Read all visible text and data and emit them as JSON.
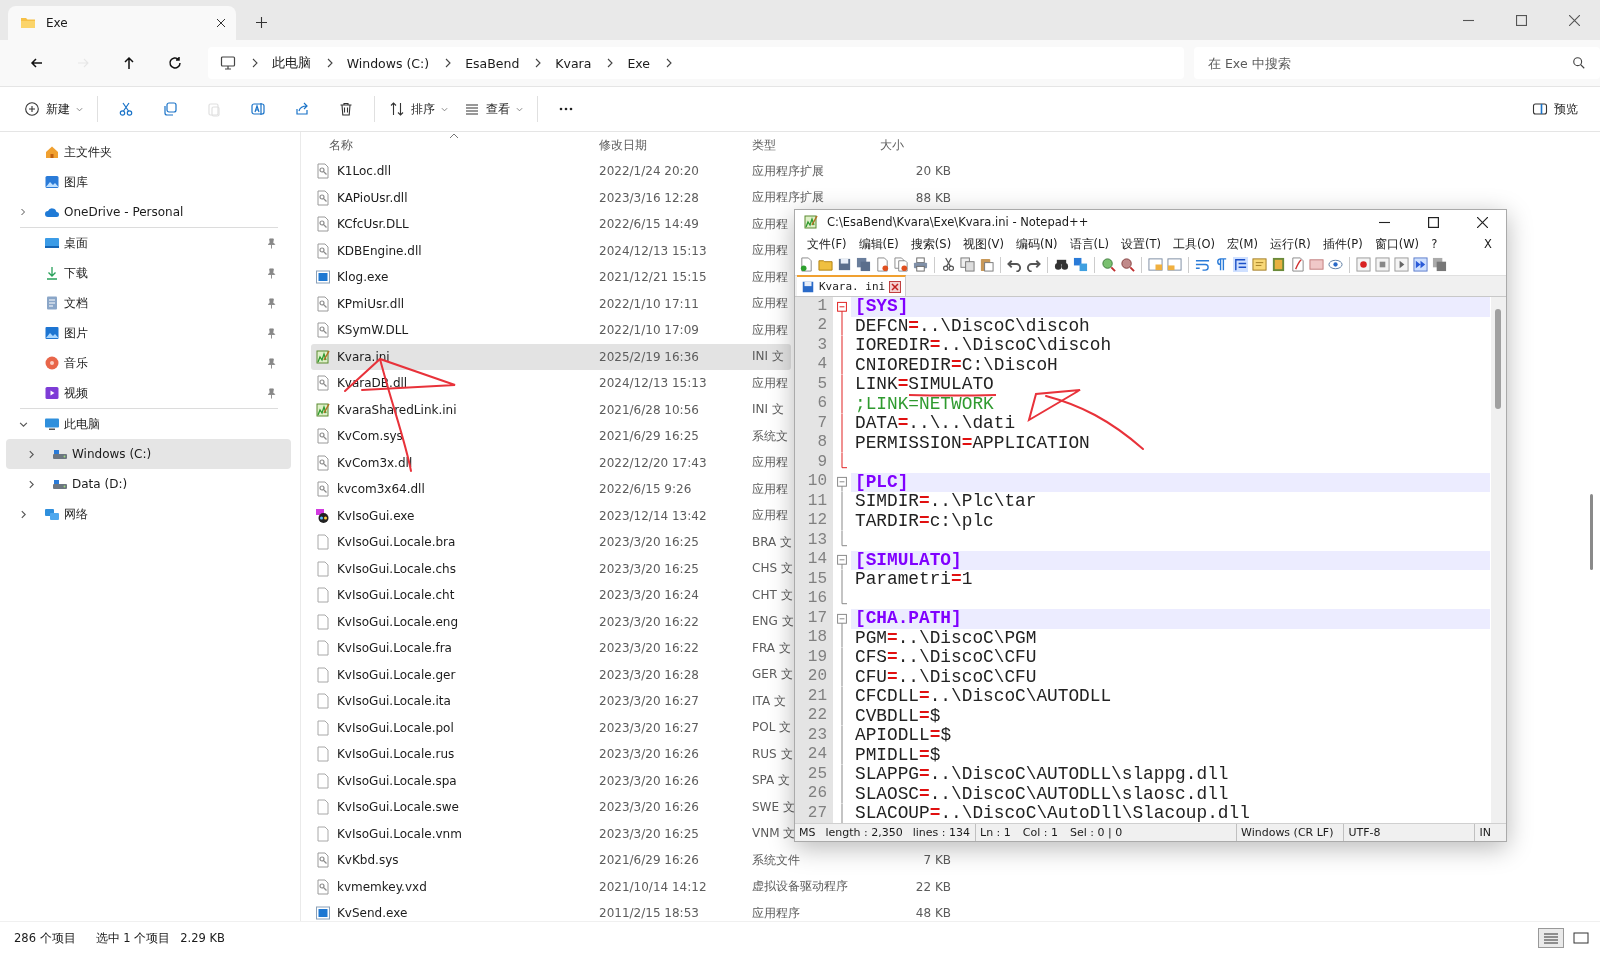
{
  "tabs": [
    {
      "label": "Exe",
      "selected": true
    }
  ],
  "nav": [
    {
      "kind": "back",
      "disabled": false
    },
    {
      "kind": "forward",
      "disabled": true
    },
    {
      "kind": "up",
      "disabled": false
    },
    {
      "kind": "refresh",
      "disabled": false
    }
  ],
  "address": {
    "segments": [
      "此电脑",
      "Windows (C:)",
      "EsaBend",
      "Kvara",
      "Exe"
    ]
  },
  "search": {
    "placeholder": "在 Exe 中搜索"
  },
  "commands": [
    {
      "kind": "new",
      "label": "新建",
      "disabled": false
    },
    {
      "kind": "cut",
      "disabled": false
    },
    {
      "kind": "copy",
      "disabled": false
    },
    {
      "kind": "paste",
      "disabled": true
    },
    {
      "kind": "rename",
      "disabled": false
    },
    {
      "kind": "share",
      "disabled": false
    },
    {
      "kind": "delete",
      "disabled": false
    },
    {
      "kind": "sort",
      "label": "排序",
      "disabled": false
    },
    {
      "kind": "view",
      "label": "查看",
      "disabled": false
    },
    {
      "kind": "more",
      "disabled": false
    }
  ],
  "preview": {
    "label": "预览"
  },
  "sidebar": {
    "top": [
      {
        "kind": "home",
        "label": "主文件夹"
      },
      {
        "kind": "gallery",
        "label": "图库"
      },
      {
        "kind": "cloud",
        "label": "OneDrive - Personal",
        "expanded": false
      }
    ],
    "pinned": [
      {
        "kind": "desktop",
        "label": "桌面",
        "pinned": true
      },
      {
        "kind": "download",
        "label": "下载",
        "pinned": true
      },
      {
        "kind": "docs",
        "label": "文档",
        "pinned": true
      },
      {
        "kind": "pictures",
        "label": "图片",
        "pinned": true
      },
      {
        "kind": "music",
        "label": "音乐",
        "pinned": true
      },
      {
        "kind": "videos",
        "label": "视频",
        "pinned": true
      }
    ],
    "tree": [
      {
        "kind": "pc",
        "label": "此电脑",
        "expanded": true,
        "selected": false,
        "children": [
          {
            "kind": "drive",
            "label": "Windows (C:)",
            "expanded": false,
            "selected": true
          },
          {
            "kind": "drive",
            "label": "Data (D:)",
            "expanded": false,
            "selected": false
          }
        ]
      },
      {
        "kind": "network",
        "label": "网络",
        "expanded": false,
        "selected": false
      }
    ]
  },
  "files": {
    "columns": [
      "名称",
      "修改日期",
      "类型",
      "大小"
    ],
    "rows": [
      {
        "kind": "dll",
        "name": "K1Loc.dll",
        "date": "2022/1/24 20:20",
        "type": "应用程序扩展",
        "size": "20 KB",
        "selected": false
      },
      {
        "kind": "dll",
        "name": "KAPioUsr.dll",
        "date": "2023/3/16 12:28",
        "type": "应用程序扩展",
        "size": "88 KB",
        "selected": false
      },
      {
        "kind": "dll",
        "name": "KCfcUsr.DLL",
        "date": "2022/6/15 14:49",
        "type": "应用程",
        "selected": false
      },
      {
        "kind": "dll",
        "name": "KDBEngine.dll",
        "date": "2024/12/13 15:13",
        "type": "应用程",
        "selected": false
      },
      {
        "kind": "exe",
        "name": "Klog.exe",
        "date": "2021/12/21 15:15",
        "type": "应用程",
        "selected": false
      },
      {
        "kind": "dll",
        "name": "KPmiUsr.dll",
        "date": "2022/1/10 17:11",
        "type": "应用程",
        "selected": false
      },
      {
        "kind": "dll",
        "name": "KSymW.DLL",
        "date": "2022/1/10 17:09",
        "type": "应用程",
        "selected": false
      },
      {
        "kind": "ini",
        "name": "Kvara.ini",
        "date": "2025/2/19 16:36",
        "type": "INI 文",
        "selected": true
      },
      {
        "kind": "dll",
        "name": "KvaraDB.dll",
        "date": "2024/12/13 15:13",
        "type": "应用程",
        "selected": false
      },
      {
        "kind": "ini",
        "name": "KvaraSharedLink.ini",
        "date": "2021/6/28 10:56",
        "type": "INI 文",
        "selected": false
      },
      {
        "kind": "dll",
        "name": "KvCom.sys",
        "date": "2021/6/29 16:25",
        "type": "系统文",
        "selected": false
      },
      {
        "kind": "dll",
        "name": "KvCom3x.dll",
        "date": "2022/12/20 17:43",
        "type": "应用程",
        "selected": false
      },
      {
        "kind": "dll",
        "name": "kvcom3x64.dll",
        "date": "2022/6/15 9:26",
        "type": "应用程",
        "selected": false
      },
      {
        "kind": "app",
        "name": "KvIsoGui.exe",
        "date": "2023/12/14 13:42",
        "type": "应用程",
        "selected": false
      },
      {
        "kind": "blank",
        "name": "KvIsoGui.Locale.bra",
        "date": "2023/3/20 16:25",
        "type": "BRA 文",
        "selected": false
      },
      {
        "kind": "blank",
        "name": "KvIsoGui.Locale.chs",
        "date": "2023/3/20 16:25",
        "type": "CHS 文",
        "selected": false
      },
      {
        "kind": "blank",
        "name": "KvIsoGui.Locale.cht",
        "date": "2023/3/20 16:24",
        "type": "CHT 文",
        "selected": false
      },
      {
        "kind": "blank",
        "name": "KvIsoGui.Locale.eng",
        "date": "2023/3/20 16:22",
        "type": "ENG 文",
        "selected": false
      },
      {
        "kind": "blank",
        "name": "KvIsoGui.Locale.fra",
        "date": "2023/3/20 16:22",
        "type": "FRA 文",
        "selected": false
      },
      {
        "kind": "blank",
        "name": "KvIsoGui.Locale.ger",
        "date": "2023/3/20 16:28",
        "type": "GER 文",
        "selected": false
      },
      {
        "kind": "blank",
        "name": "KvIsoGui.Locale.ita",
        "date": "2023/3/20 16:27",
        "type": "ITA 文",
        "selected": false
      },
      {
        "kind": "blank",
        "name": "KvIsoGui.Locale.pol",
        "date": "2023/3/20 16:27",
        "type": "POL 文",
        "selected": false
      },
      {
        "kind": "blank",
        "name": "KvIsoGui.Locale.rus",
        "date": "2023/3/20 16:26",
        "type": "RUS 文",
        "selected": false
      },
      {
        "kind": "blank",
        "name": "KvIsoGui.Locale.spa",
        "date": "2023/3/20 16:26",
        "type": "SPA 文",
        "selected": false
      },
      {
        "kind": "blank",
        "name": "KvIsoGui.Locale.swe",
        "date": "2023/3/20 16:26",
        "type": "SWE 文",
        "selected": false
      },
      {
        "kind": "blank",
        "name": "KvIsoGui.Locale.vnm",
        "date": "2023/3/20 16:25",
        "type": "VNM 文",
        "selected": false
      },
      {
        "kind": "dll",
        "name": "KvKbd.sys",
        "date": "2021/6/29 16:26",
        "type": "系统文件",
        "size": "7 KB",
        "selected": false
      },
      {
        "kind": "dll",
        "name": "kvmemkey.vxd",
        "date": "2021/10/14 14:12",
        "type": "虚拟设备驱动程序",
        "size": "22 KB",
        "selected": false
      },
      {
        "kind": "exe",
        "name": "KvSend.exe",
        "date": "2011/2/15 18:53",
        "type": "应用程序",
        "size": "48 KB",
        "selected": false
      }
    ]
  },
  "status_bar": {
    "count": "286 个项目",
    "selection": "选中 1 个项目",
    "selection_size": "2.29 KB"
  },
  "views": [
    {
      "kind": "details",
      "selected": true
    },
    {
      "kind": "tiles",
      "selected": false
    }
  ],
  "notepad": {
    "title": "C:\\EsaBend\\Kvara\\Exe\\Kvara.ini - Notepad++",
    "menu": [
      "文件(F)",
      "编辑(E)",
      "搜索(S)",
      "视图(V)",
      "编码(N)",
      "语言(L)",
      "设置(T)",
      "工具(O)",
      "宏(M)",
      "运行(R)",
      "插件(P)",
      "窗口(W)",
      "?"
    ],
    "menu_close": "X",
    "tabs": [
      {
        "label": "Kvara. ini",
        "selected": true
      }
    ],
    "lines": [
      {
        "n": "1",
        "kind": "section",
        "text": "[SYS]",
        "active": true
      },
      {
        "n": "2",
        "kind": "pair",
        "text": "DEFCN=..\\DiscoC\\discoh"
      },
      {
        "n": "3",
        "kind": "pair",
        "text": "IOREDIR=..\\DiscoC\\discoh"
      },
      {
        "n": "4",
        "kind": "pair",
        "text": "CNIOREDIR=C:\\DiscoH"
      },
      {
        "n": "5",
        "kind": "pair",
        "text": "LINK=SIMULATO"
      },
      {
        "n": "6",
        "kind": "comment",
        "text": ";LINK=NETWORK"
      },
      {
        "n": "7",
        "kind": "pair",
        "text": "DATA=..\\..\\dati"
      },
      {
        "n": "8",
        "kind": "pair",
        "text": "PERMISSION=APPLICATION"
      },
      {
        "n": "9",
        "kind": "blank"
      },
      {
        "n": "10",
        "kind": "section",
        "text": "[PLC]",
        "active": false
      },
      {
        "n": "11",
        "kind": "pair",
        "text": "SIMDIR=..\\Plc\\tar"
      },
      {
        "n": "12",
        "kind": "pair",
        "text": "TARDIR=c:\\plc"
      },
      {
        "n": "13",
        "kind": "blank"
      },
      {
        "n": "14",
        "kind": "section",
        "text": "[SIMULATO]",
        "active": false
      },
      {
        "n": "15",
        "kind": "pair",
        "text": "Parametri=1"
      },
      {
        "n": "16",
        "kind": "blank"
      },
      {
        "n": "17",
        "kind": "section",
        "text": "[CHA.PATH]",
        "active": false
      },
      {
        "n": "18",
        "kind": "pair",
        "text": "PGM=..\\DiscoC\\PGM"
      },
      {
        "n": "19",
        "kind": "pair",
        "text": "CFS=..\\DiscoC\\CFU"
      },
      {
        "n": "20",
        "kind": "pair",
        "text": "CFU=..\\DiscoC\\CFU"
      },
      {
        "n": "21",
        "kind": "pair",
        "text": "CFCDLL=..\\DiscoC\\AUTODLL"
      },
      {
        "n": "22",
        "kind": "pair",
        "text": "CVBDLL=$"
      },
      {
        "n": "23",
        "kind": "pair",
        "text": "APIODLL=$"
      },
      {
        "n": "24",
        "kind": "pair",
        "text": "PMIDLL=$"
      },
      {
        "n": "25",
        "kind": "pair",
        "text": "SLAPPG=..\\DiscoC\\AUTODLL\\slappg.dll"
      },
      {
        "n": "26",
        "kind": "pair",
        "text": "SLAOSC=..\\DiscoC\\AUTODLL\\slaosc.dll"
      },
      {
        "n": "27",
        "kind": "pair",
        "text": "SLACOUP=..\\DiscoC\\AutoDll\\Slacoup.dll"
      }
    ],
    "status": [
      [
        "MS",
        "length : 2,350",
        "lines : 134"
      ],
      [
        "Ln : 1",
        "Col : 1",
        "Sel : 0 | 0"
      ],
      [
        "Windows (CR LF)"
      ],
      [
        "UTF-8"
      ],
      [
        "IN"
      ]
    ]
  }
}
